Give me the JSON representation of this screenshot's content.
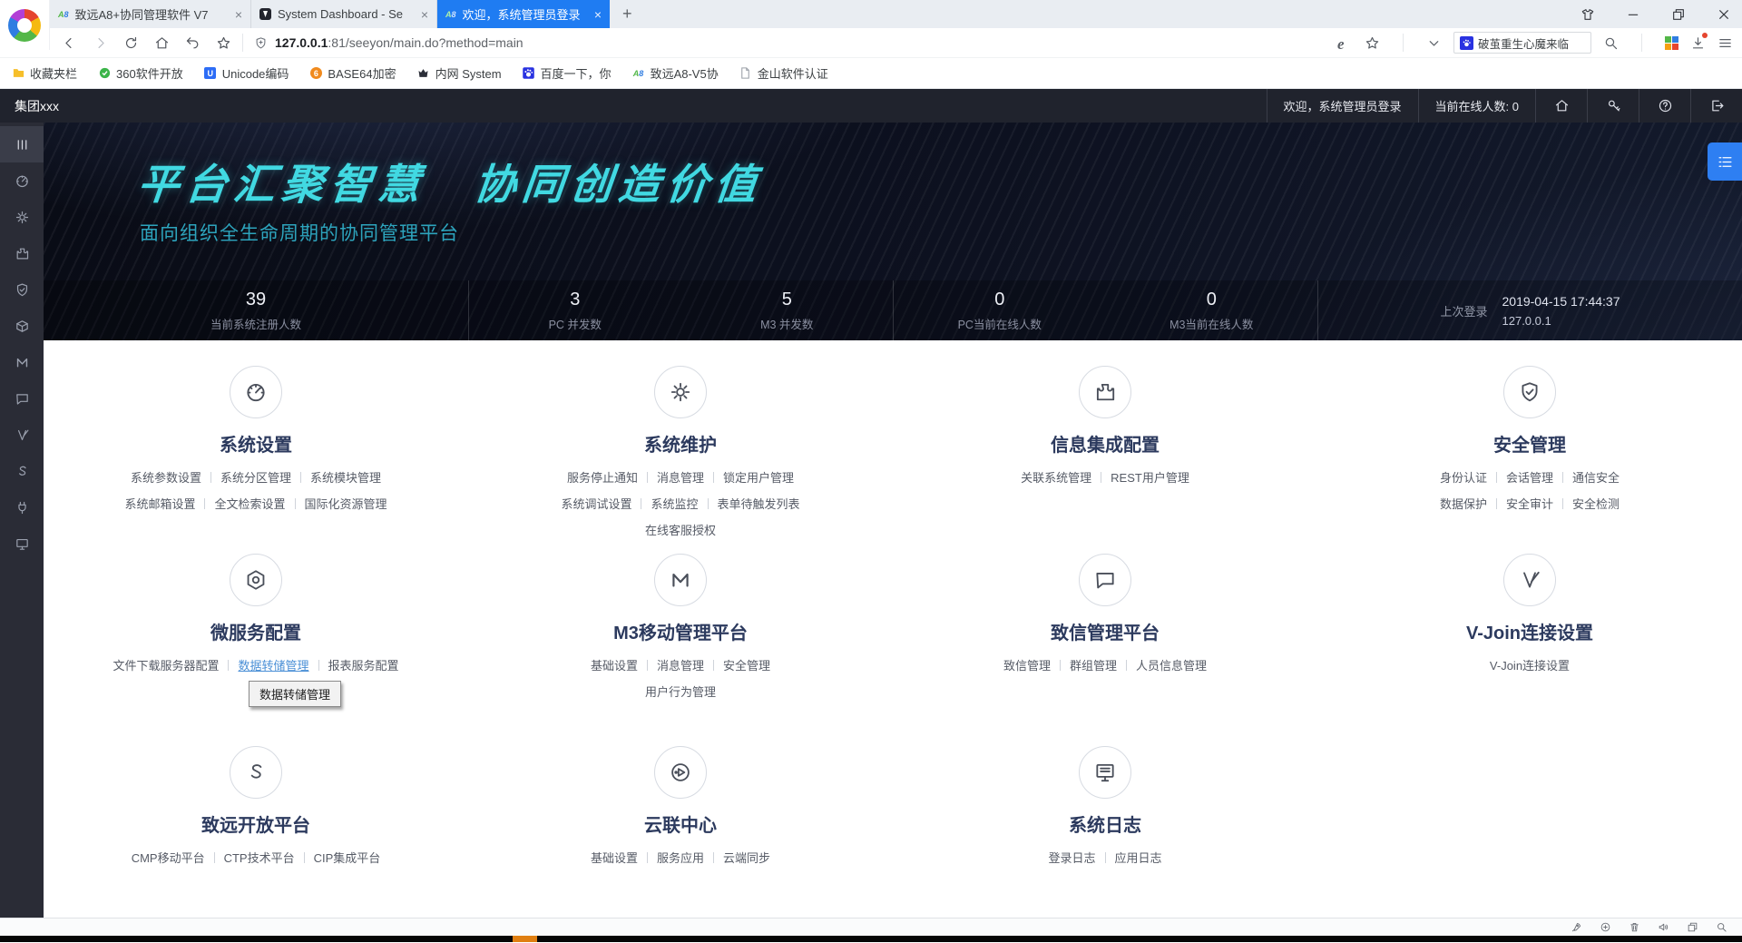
{
  "browser": {
    "tabs": [
      {
        "title": "致远A8+协同管理软件 V7",
        "favicon": "a8-favicon",
        "active": false
      },
      {
        "title": "System Dashboard - Se",
        "favicon": "dashboard-favicon",
        "active": false
      },
      {
        "title": "欢迎，系统管理员登录",
        "favicon": "a8-favicon",
        "active": true
      }
    ],
    "new_tab_label": "+",
    "window_controls": [
      "skin-icon",
      "minimize-icon",
      "restore-icon",
      "close-icon"
    ],
    "nav_icons": [
      "back-icon",
      "forward-icon",
      "reload-icon",
      "home-icon",
      "undo-icon",
      "star-outline-icon"
    ],
    "address": {
      "host": "127.0.0.1",
      "rest": ":81/seeyon/main.do?method=main",
      "security_icon": "shield-icon"
    },
    "right_icons": [
      "ie-icon",
      "star-outline-icon",
      "chevron-down-icon"
    ],
    "search": {
      "engine_icon": "paw-icon",
      "text": "破茧重生心魔来临",
      "magnifier_icon": "search-icon"
    },
    "toolbar_right": [
      "apps-grid-icon",
      "download-icon",
      "hamburger-menu-icon"
    ],
    "bookmarks": [
      {
        "label": "收藏夹栏",
        "icon": "folder-icon"
      },
      {
        "label": "360软件开放",
        "icon": "globe-green-icon"
      },
      {
        "label": "Unicode编码",
        "icon": "unicode-icon"
      },
      {
        "label": "BASE64加密",
        "icon": "base64-icon"
      },
      {
        "label": "内网 System",
        "icon": "crown-icon"
      },
      {
        "label": "百度一下，你",
        "icon": "paw-icon"
      },
      {
        "label": "致远A8-V5协",
        "icon": "a8-icon"
      },
      {
        "label": "金山软件认证",
        "icon": "page-icon"
      }
    ]
  },
  "app_header": {
    "org": "集团xxx",
    "welcome": "欢迎，系统管理员登录",
    "online_count": "当前在线人数: 0",
    "action_icons": [
      "home-icon",
      "key-icon",
      "help-icon",
      "logout-icon"
    ]
  },
  "sidebar": {
    "icons": [
      "menu-bars-icon",
      "dashboard-icon",
      "gear-icon",
      "puzzle-icon",
      "shield-check-icon",
      "package-icon",
      "m3-icon",
      "chat-icon",
      "vjoin-icon",
      "s-swirl-icon",
      "plug-icon",
      "monitor-icon"
    ]
  },
  "hero": {
    "slogan": "平台汇聚智慧　协同创造价值",
    "subtitle": "面向组织全生命周期的协同管理平台",
    "menu_button_icon": "list-menu-icon"
  },
  "stats": {
    "groups": [
      [
        {
          "value": "39",
          "label": "当前系统注册人数"
        }
      ],
      [
        {
          "value": "3",
          "label": "PC 并发数"
        },
        {
          "value": "5",
          "label": "M3 并发数"
        }
      ],
      [
        {
          "value": "0",
          "label": "PC当前在线人数"
        },
        {
          "value": "0",
          "label": "M3当前在线人数"
        }
      ]
    ],
    "last_login": {
      "label": "上次登录",
      "time": "2019-04-15 17:44:37",
      "ip": "127.0.0.1"
    }
  },
  "cards": [
    {
      "title": "系统设置",
      "icon": "gauge-icon",
      "rows": [
        [
          "系统参数设置",
          "系统分区管理",
          "系统模块管理"
        ],
        [
          "系统邮箱设置",
          "全文检索设置",
          "国际化资源管理"
        ]
      ]
    },
    {
      "title": "系统维护",
      "icon": "gear-icon",
      "rows": [
        [
          "服务停止通知",
          "消息管理",
          "锁定用户管理"
        ],
        [
          "系统调试设置",
          "系统监控",
          "表单待触发列表"
        ],
        [
          "在线客服授权"
        ]
      ]
    },
    {
      "title": "信息集成配置",
      "icon": "puzzle-icon",
      "rows": [
        [
          "关联系统管理",
          "REST用户管理"
        ]
      ]
    },
    {
      "title": "安全管理",
      "icon": "shield-check-icon",
      "rows": [
        [
          "身份认证",
          "会话管理",
          "通信安全"
        ],
        [
          "数据保护",
          "安全审计",
          "安全检测"
        ]
      ]
    },
    {
      "title": "微服务配置",
      "icon": "hexagon-gear-icon",
      "rows": [
        [
          "文件下载服务器配置",
          "数据转储管理",
          "报表服务配置"
        ]
      ],
      "highlight": "数据转储管理",
      "tooltip": "数据转储管理"
    },
    {
      "title": "M3移动管理平台",
      "icon": "m3-icon",
      "rows": [
        [
          "基础设置",
          "消息管理",
          "安全管理"
        ],
        [
          "用户行为管理"
        ]
      ]
    },
    {
      "title": "致信管理平台",
      "icon": "chat-icon",
      "rows": [
        [
          "致信管理",
          "群组管理",
          "人员信息管理"
        ]
      ]
    },
    {
      "title": "V-Join连接设置",
      "icon": "vjoin-icon",
      "rows": [
        [
          "V-Join连接设置"
        ]
      ]
    },
    {
      "title": "致远开放平台",
      "icon": "s-swirl-icon",
      "rows": [
        [
          "CMP移动平台",
          "CTP技术平台",
          "CIP集成平台"
        ]
      ]
    },
    {
      "title": "云联中心",
      "icon": "cloud-link-icon",
      "rows": [
        [
          "基础设置",
          "服务应用",
          "云端同步"
        ]
      ]
    },
    {
      "title": "系统日志",
      "icon": "log-monitor-icon",
      "rows": [
        [
          "登录日志",
          "应用日志"
        ]
      ]
    }
  ],
  "bottom_toolbar": {
    "icons": [
      "rocket-icon",
      "speed-plus-icon",
      "trash-icon",
      "speaker-icon",
      "windows-icon",
      "zoom-icon"
    ]
  },
  "colors": {
    "accent_blue": "#1f7cf2",
    "slogan_cyan": "#41d9e2",
    "link_hover": "#4a8fd6",
    "header_dark": "#20232d"
  }
}
